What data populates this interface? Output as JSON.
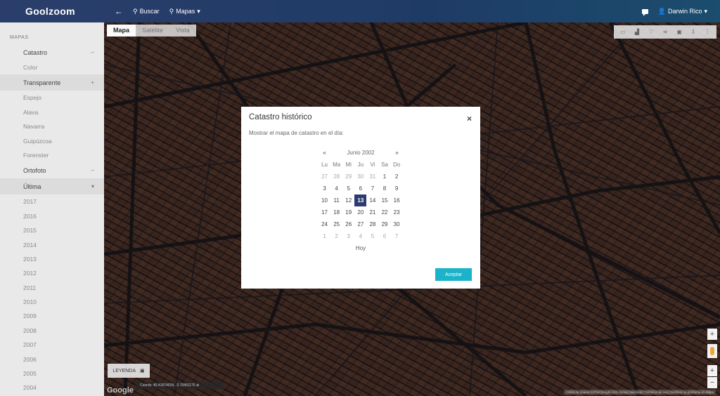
{
  "header": {
    "logo": "Goolzoom",
    "back": "←",
    "search_label": "Buscar",
    "maps_label": "Mapas",
    "user": "Darwin Rico"
  },
  "sidebar": {
    "heading": "MAPAS",
    "groups": [
      {
        "label": "Catastro",
        "toggle": "–",
        "items": [
          "Color"
        ]
      },
      {
        "label": "Transparente",
        "toggle": "+",
        "items": [
          "Espejo",
          "Alava",
          "Navarra",
          "Guipúzcoa",
          "Forenster"
        ]
      },
      {
        "label": "Ortofoto",
        "toggle": "–",
        "items": []
      },
      {
        "label": "Última",
        "toggle": "▾",
        "items": [
          "2017",
          "2016",
          "2015",
          "2014",
          "2013",
          "2012",
          "2011",
          "2010",
          "2009",
          "2008",
          "2007",
          "2006",
          "2005",
          "2004"
        ]
      }
    ]
  },
  "map": {
    "types": [
      "Mapa",
      "Satélite",
      "Vista"
    ],
    "active_type": "Mapa",
    "tools": [
      "list-icon",
      "chart-icon",
      "heart-icon",
      "share-icon",
      "print-icon",
      "download-icon",
      "more-icon"
    ],
    "legend_label": "LEYENDA",
    "coords": "Coords: 40.41874034, -3.70491175 ⊕",
    "google": "Google",
    "attribution": "Datos de mapas ©2018 Google, Inst. Geogr. Nacional  |  Términos de uso  |  Notificar un problema de Maps",
    "zoom_in": "+",
    "zoom_out": "−"
  },
  "modal": {
    "title": "Catastro histórico",
    "close": "×",
    "description": "Mostrar el mapa de catastro en el día:",
    "calendar": {
      "prev": "«",
      "next": "»",
      "month_year": "Junio 2002",
      "weekdays": [
        "Lu",
        "Ma",
        "Mi",
        "Ju",
        "Vi",
        "Sa",
        "Do"
      ],
      "weeks": [
        [
          {
            "d": "27",
            "o": true
          },
          {
            "d": "28",
            "o": true
          },
          {
            "d": "29",
            "o": true
          },
          {
            "d": "30",
            "o": true
          },
          {
            "d": "31",
            "o": true
          },
          {
            "d": "1"
          },
          {
            "d": "2"
          }
        ],
        [
          {
            "d": "3"
          },
          {
            "d": "4"
          },
          {
            "d": "5"
          },
          {
            "d": "6"
          },
          {
            "d": "7"
          },
          {
            "d": "8"
          },
          {
            "d": "9"
          }
        ],
        [
          {
            "d": "10"
          },
          {
            "d": "11"
          },
          {
            "d": "12"
          },
          {
            "d": "13",
            "s": true
          },
          {
            "d": "14"
          },
          {
            "d": "15"
          },
          {
            "d": "16"
          }
        ],
        [
          {
            "d": "17"
          },
          {
            "d": "18"
          },
          {
            "d": "19"
          },
          {
            "d": "20"
          },
          {
            "d": "21"
          },
          {
            "d": "22"
          },
          {
            "d": "23"
          }
        ],
        [
          {
            "d": "24"
          },
          {
            "d": "25"
          },
          {
            "d": "26"
          },
          {
            "d": "27"
          },
          {
            "d": "28"
          },
          {
            "d": "29"
          },
          {
            "d": "30"
          }
        ],
        [
          {
            "d": "1",
            "o": true
          },
          {
            "d": "2",
            "o": true
          },
          {
            "d": "3",
            "o": true
          },
          {
            "d": "4",
            "o": true
          },
          {
            "d": "5",
            "o": true
          },
          {
            "d": "6",
            "o": true
          },
          {
            "d": "7",
            "o": true
          }
        ]
      ],
      "today": "Hoy",
      "selected_color": "#2c3c72"
    },
    "accept": "Aceptar",
    "accept_color": "#1bb3c9"
  }
}
